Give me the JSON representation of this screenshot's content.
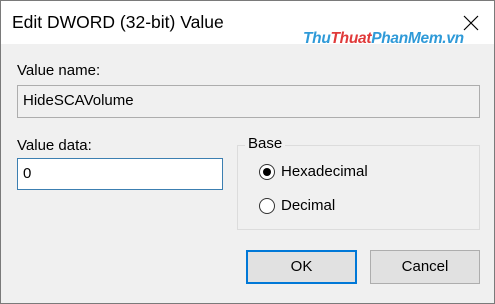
{
  "window": {
    "title": "Edit DWORD (32-bit) Value"
  },
  "watermark": {
    "part1": "Thu",
    "part2": "Thuat",
    "part3": "PhanMem.vn"
  },
  "value_name": {
    "label": "Value name:",
    "value": "HideSCAVolume"
  },
  "value_data": {
    "label": "Value data:",
    "value": "0"
  },
  "base": {
    "legend": "Base",
    "options": [
      {
        "label": "Hexadecimal",
        "selected": true
      },
      {
        "label": "Decimal",
        "selected": false
      }
    ]
  },
  "buttons": {
    "ok": "OK",
    "cancel": "Cancel"
  },
  "icons": {
    "close": "close-icon"
  }
}
